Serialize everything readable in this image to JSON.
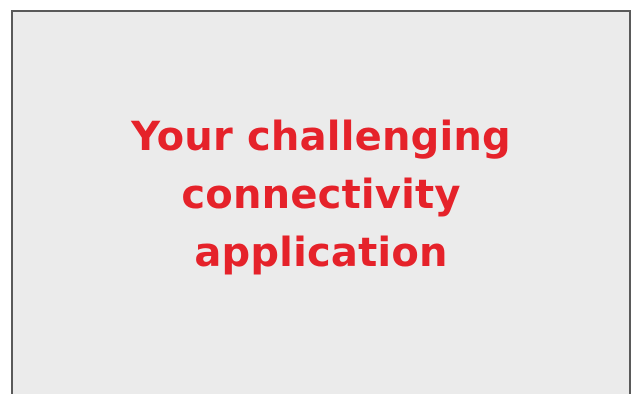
{
  "headline": {
    "lines": [
      "Your challenging",
      "connectivity",
      "application"
    ]
  },
  "colors": {
    "text": "#e5222a",
    "panel_background": "#ebebeb",
    "panel_border": "#5a5a5a"
  }
}
